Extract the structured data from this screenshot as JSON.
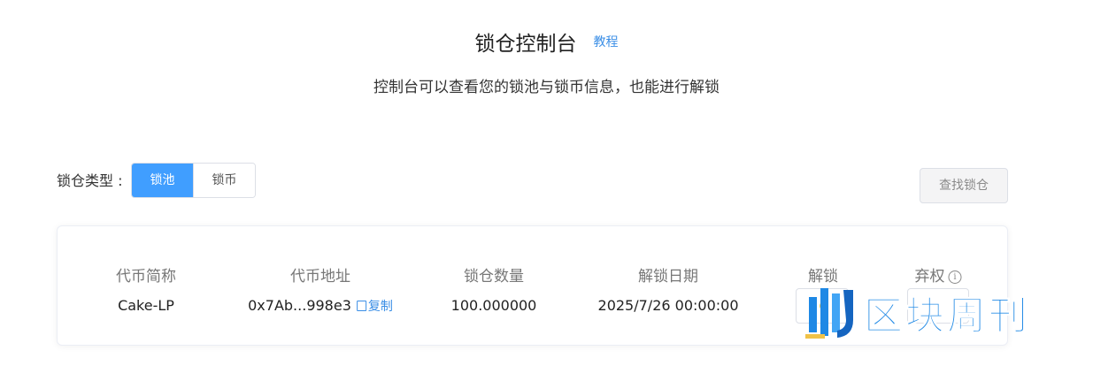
{
  "header": {
    "title": "锁仓控制台",
    "tutorial_link": "教程",
    "subtitle": "控制台可以查看您的锁池与锁币信息，也能进行解锁"
  },
  "filter": {
    "label": "锁仓类型 :",
    "options": [
      "锁池",
      "锁币"
    ],
    "selected": "锁池",
    "search_button": "查找锁仓"
  },
  "table": {
    "columns": [
      "代币简称",
      "代币地址",
      "锁仓数量",
      "解锁日期",
      "解锁",
      "弃权"
    ],
    "rows": [
      {
        "token_name": "Cake-LP",
        "address": "0x7Ab...998e3",
        "copy_label": "复制",
        "amount": "100.000000",
        "unlock_date": "2025/7/26 00:00:00"
      }
    ]
  },
  "watermark": {
    "text": "区块周刊"
  },
  "colors": {
    "accent": "#409eff",
    "link": "#3a8ee6",
    "watermark": "#1e88e5"
  },
  "icons": [
    "info-icon",
    "copy-icon",
    "watermark-logo-icon"
  ]
}
